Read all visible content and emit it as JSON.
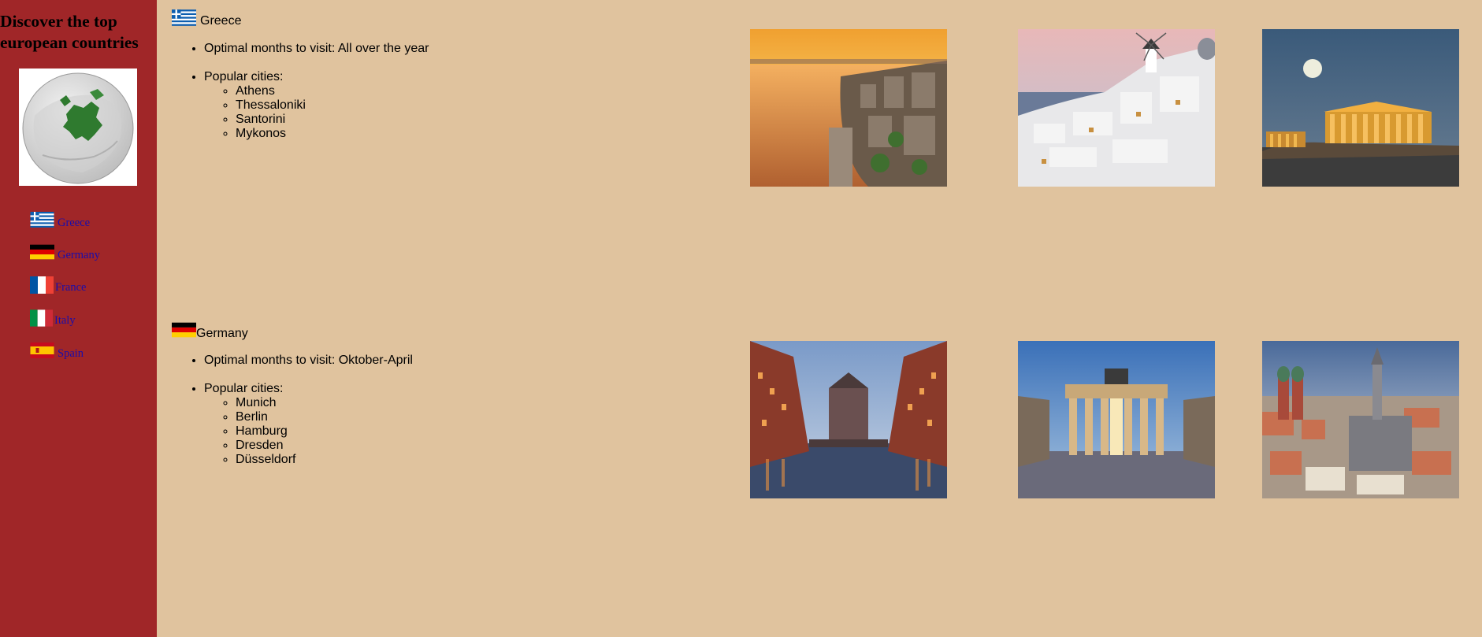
{
  "sidebar": {
    "title_line1": "Discover the top",
    "title_line2": "european countries",
    "globe_icon": "europe-globe-map",
    "links": [
      {
        "label": "Greece",
        "flag": "greece-flag-icon"
      },
      {
        "label": "Germany",
        "flag": "germany-flag-icon"
      },
      {
        "label": "France",
        "flag": "france-flag-icon"
      },
      {
        "label": "Italy",
        "flag": "italy-flag-icon"
      },
      {
        "label": "Spain",
        "flag": "spain-flag-icon"
      }
    ]
  },
  "countries": [
    {
      "name": "Greece",
      "months_label": "Optimal months to visit: All over the year",
      "cities_label": "Popular cities:",
      "cities": [
        "Athens",
        "Thessaloniki",
        "Santorini",
        "Mykonos"
      ],
      "photos": [
        "thessaloniki-waterfront-sunset-photo",
        "santorini-windmill-village-photo",
        "acropolis-parthenon-night-photo"
      ]
    },
    {
      "name": "Germany",
      "months_label": "Optimal months to visit: Oktober-April",
      "cities_label": "Popular cities:",
      "cities": [
        "Munich",
        "Berlin",
        "Hamburg",
        "Dresden",
        "Düsseldorf"
      ],
      "photos": [
        "hamburg-speicherstadt-canal-photo",
        "brandenburg-gate-photo",
        "munich-marienplatz-aerial-photo"
      ]
    }
  ],
  "colors": {
    "sidebar_bg": "#a02628",
    "page_bg": "#e0c39e",
    "link": "#1a0dab"
  }
}
